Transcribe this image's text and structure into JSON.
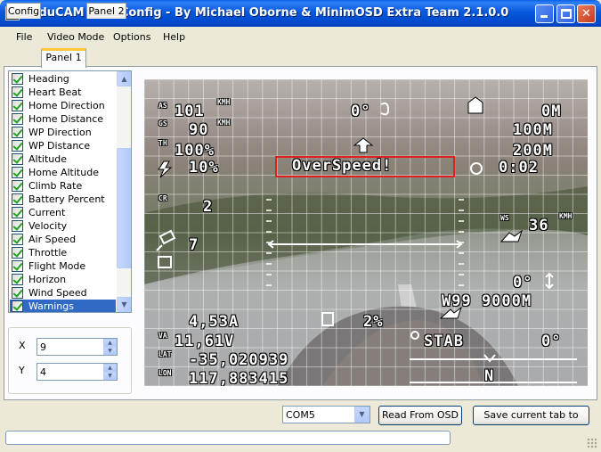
{
  "window": {
    "title": "ArduCAM OSD Config - By Michael Oborne & MinimOSD Extra Team 2.1.0.0"
  },
  "menu": [
    "File",
    "Video Mode",
    "Options",
    "Help"
  ],
  "tabs": [
    {
      "label": "Config",
      "active": false
    },
    {
      "label": "Panel 1",
      "active": true
    },
    {
      "label": "Panel 2",
      "active": false
    }
  ],
  "items": [
    {
      "label": "Heading",
      "checked": true,
      "selected": false
    },
    {
      "label": "Heart Beat",
      "checked": true,
      "selected": false
    },
    {
      "label": "Home Direction",
      "checked": true,
      "selected": false
    },
    {
      "label": "Home Distance",
      "checked": true,
      "selected": false
    },
    {
      "label": "WP Direction",
      "checked": true,
      "selected": false
    },
    {
      "label": "WP Distance",
      "checked": true,
      "selected": false
    },
    {
      "label": "Altitude",
      "checked": true,
      "selected": false
    },
    {
      "label": "Home Altitude",
      "checked": true,
      "selected": false
    },
    {
      "label": "Climb Rate",
      "checked": true,
      "selected": false
    },
    {
      "label": "Battery Percent",
      "checked": true,
      "selected": false
    },
    {
      "label": "Current",
      "checked": true,
      "selected": false
    },
    {
      "label": "Velocity",
      "checked": true,
      "selected": false
    },
    {
      "label": "Air Speed",
      "checked": true,
      "selected": false
    },
    {
      "label": "Throttle",
      "checked": true,
      "selected": false
    },
    {
      "label": "Flight Mode",
      "checked": true,
      "selected": false
    },
    {
      "label": "Horizon",
      "checked": true,
      "selected": false
    },
    {
      "label": "Wind Speed",
      "checked": true,
      "selected": false
    },
    {
      "label": "Warnings",
      "checked": true,
      "selected": true
    }
  ],
  "position": {
    "x_label": "X",
    "x_value": "9",
    "y_label": "Y",
    "y_value": "4"
  },
  "osd": {
    "as_label": "AS",
    "as_unit": "KMH",
    "gs_label": "GS",
    "gs_unit": "KMH",
    "th_label": "TH",
    "airspeed": "101",
    "groundspeed": "90",
    "throttle": "100%",
    "battery": "10%",
    "heading": "0°",
    "home_distance": "0M",
    "home_altitude": "100M",
    "altitude": "200M",
    "flight_time": "0:02",
    "warning": "OverSpeed!",
    "climb": "2",
    "climb_label": "CR",
    "wind_speed": "36",
    "wind_label": "WS",
    "wind_unit": "KMH",
    "sats": "7",
    "wp_direction": "0°",
    "wp": "W99 9000M",
    "current": "4,53A",
    "battery_percent": "2%",
    "voltage": "11,61V",
    "mode": "STAB",
    "roll": "0°",
    "latitude": "-35,020939",
    "longitude": "117,883415",
    "compass": "N",
    "va_label": "VA",
    "lat_label": "LAT",
    "lon_label": "LON"
  },
  "bottom": {
    "com_port": "COM5",
    "read_button": "Read From OSD",
    "save_button": "Save current tab to"
  }
}
